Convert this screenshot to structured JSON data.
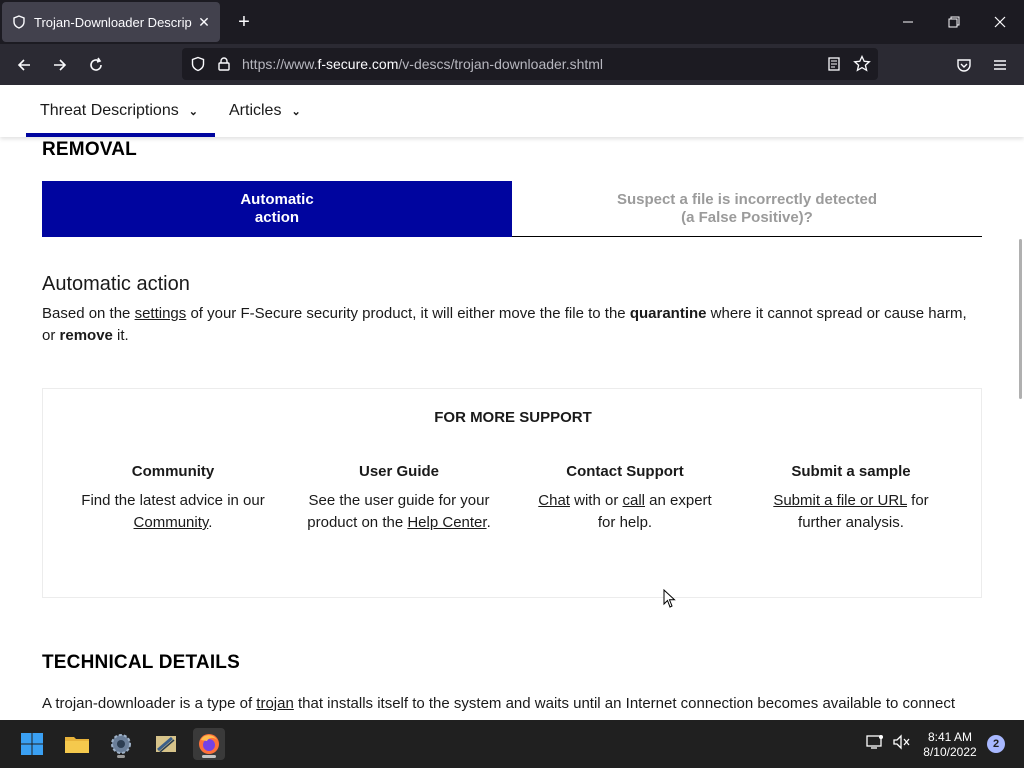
{
  "browser": {
    "tab_title": "Trojan-Downloader Description",
    "url_prefix": "https://www.",
    "url_domain": "f-secure.com",
    "url_path": "/v-descs/trojan-downloader.shtml"
  },
  "site_nav": {
    "items": [
      {
        "label": "Threat Descriptions"
      },
      {
        "label": "Articles"
      }
    ]
  },
  "removal": {
    "heading": "REMOVAL",
    "toggle_active_line1": "Automatic",
    "toggle_active_line2": "action",
    "toggle_inactive_line1": "Suspect a file is incorrectly detected",
    "toggle_inactive_line2": "(a False Positive)?",
    "auto_title": "Automatic action",
    "body_part1": "Based on the ",
    "body_link": "settings",
    "body_part2": " of your F-Secure security product, it will either move the file to the ",
    "body_bold1": "quarantine",
    "body_part3": " where it cannot spread or cause harm, or ",
    "body_bold2": "remove",
    "body_part4": " it."
  },
  "support": {
    "title": "FOR MORE SUPPORT",
    "community": {
      "title": "Community",
      "text1": "Find the latest advice in our ",
      "link": "Community",
      "text2": "."
    },
    "user_guide": {
      "title": "User Guide",
      "text1": "See the user guide for your product on the ",
      "link": "Help Center",
      "text2": "."
    },
    "contact": {
      "title": "Contact Support",
      "link1": "Chat",
      "text1": " with or ",
      "link2": "call",
      "text2": " an expert for help."
    },
    "sample": {
      "title": "Submit a sample",
      "link": "Submit a file or URL",
      "text1": " for further analysis."
    }
  },
  "technical": {
    "heading": "TECHNICAL DETAILS",
    "text1": "A trojan-downloader is a type of ",
    "link": "trojan",
    "text2": " that installs itself to the system and waits until an Internet connection becomes available to connect"
  },
  "taskbar": {
    "time": "8:41 AM",
    "date": "8/10/2022",
    "notifications": "2"
  },
  "colors": {
    "accent": "#00059f",
    "chrome_dark": "#1c1b22",
    "toolbar": "#2b2a33"
  }
}
